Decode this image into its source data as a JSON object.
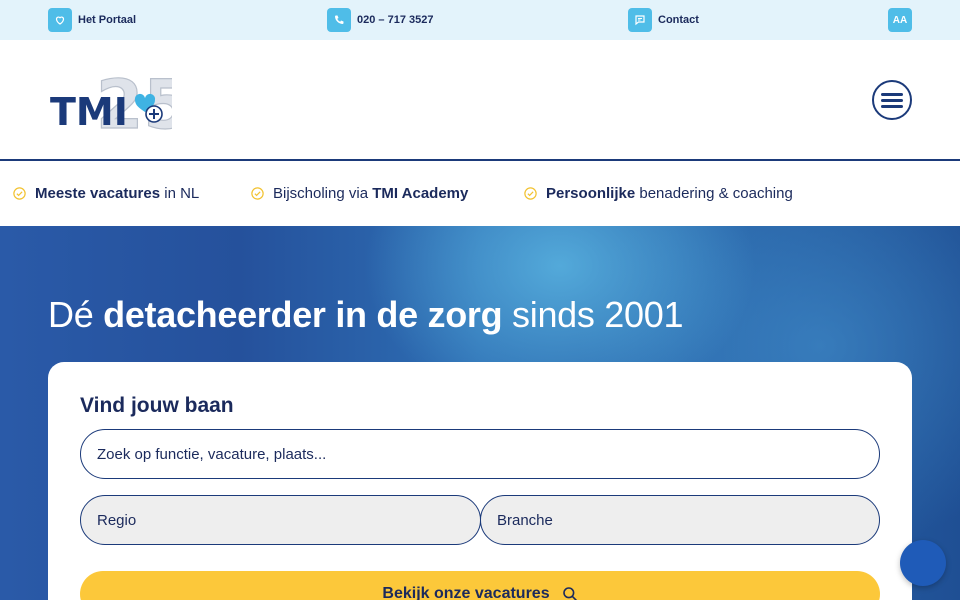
{
  "topbar": {
    "portal_label": "Het Portaal",
    "phone_label": "020 – 717 3527",
    "contact_label": "Contact",
    "font_size_label": "AA"
  },
  "header": {
    "logo_text": "TMI",
    "logo_number": "25",
    "menu_icon": "hamburger-menu-icon"
  },
  "usps": [
    {
      "bold": "Meeste vacatures",
      "rest": " in NL"
    },
    {
      "pre": "Bijscholing via ",
      "bold": "TMI Academy"
    },
    {
      "bold": "Persoonlijke",
      "rest": " benadering & coaching"
    }
  ],
  "hero": {
    "title_pre": "Dé ",
    "title_bold": "detacheerder in de zorg",
    "title_post": " sinds 2001"
  },
  "search": {
    "title": "Vind jouw baan",
    "placeholder": "Zoek op functie, vacature, plaats...",
    "regio_label": "Regio",
    "branche_label": "Branche",
    "cta_label": "Bekijk onze vacatures"
  },
  "colors": {
    "navy": "#1b2a5c",
    "accent_blue": "#4fbde8",
    "topbar_bg": "#e3f3fb",
    "cta_yellow": "#fcc83a",
    "check_yellow": "#f2c230"
  }
}
